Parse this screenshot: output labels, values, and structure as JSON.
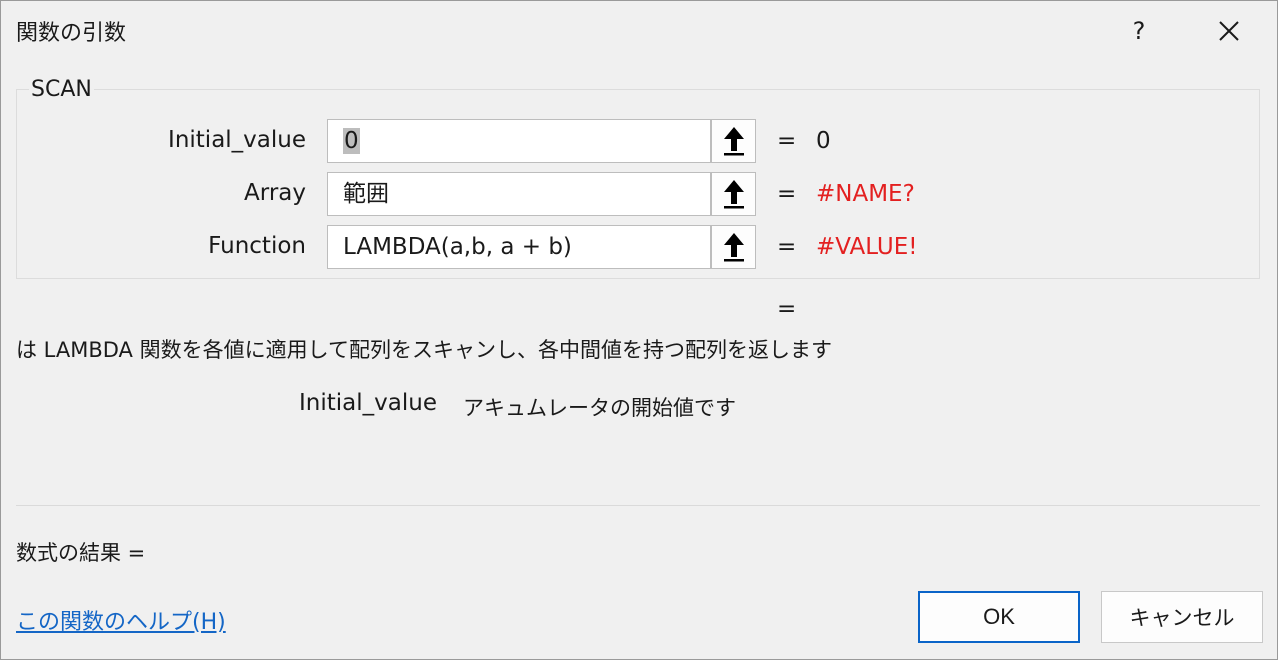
{
  "window": {
    "title": "関数の引数",
    "help_label": "?",
    "close_icon": "close-icon"
  },
  "function_group": {
    "name": "SCAN",
    "args": [
      {
        "label": "Initial_value",
        "value": "0",
        "result": "0"
      },
      {
        "label": "Array",
        "value": "範囲",
        "result": "#NAME?"
      },
      {
        "label": "Function",
        "value": "LAMBDA(a,b, a + b)",
        "result": "#VALUE!"
      }
    ],
    "equals_sign": "="
  },
  "overall_equals": "=",
  "description": "は LAMBDA 関数を各値に適用して配列をスキャンし、各中間値を持つ配列を返します",
  "arg_help": {
    "name": "Initial_value",
    "text": "アキュムレータの開始値です"
  },
  "formula_result_label": "数式の結果 =",
  "help_link": "この関数のヘルプ(H)",
  "buttons": {
    "ok": "OK",
    "cancel": "キャンセル"
  },
  "colors": {
    "error": "#e32020",
    "link": "#1466c6",
    "focus_border": "#0a64c8"
  },
  "icons": {
    "ref_button": "collapse-dialog-arrow-up-icon"
  }
}
